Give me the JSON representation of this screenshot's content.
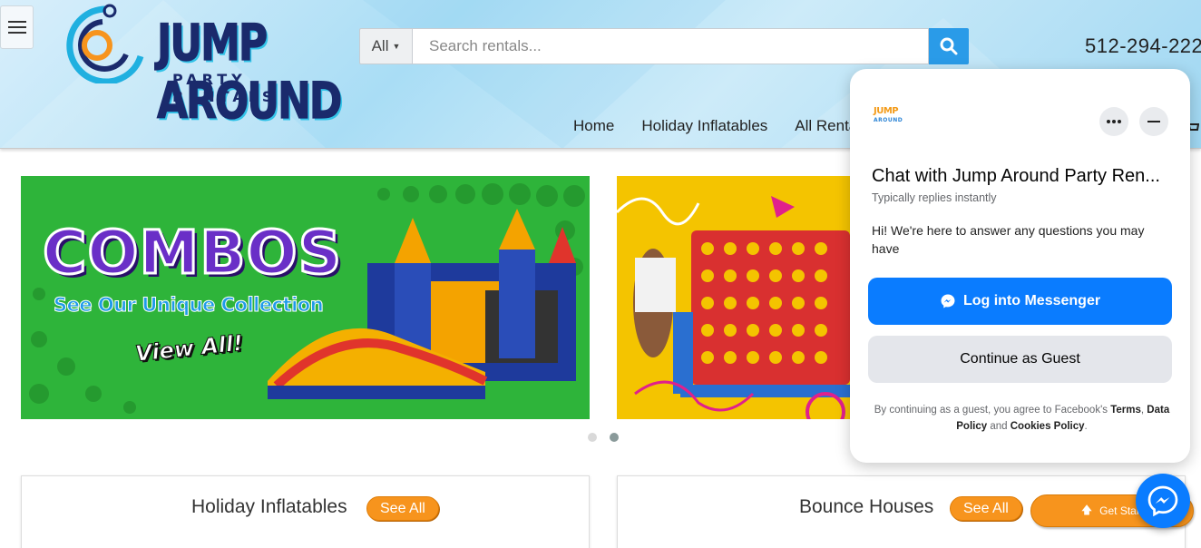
{
  "header": {
    "logo_main": "JUMP AROUND",
    "logo_sub": "PARTY RENTALS",
    "phone": "512-294-222",
    "search": {
      "category": "All",
      "placeholder": "Search rentals..."
    },
    "nav": [
      "Home",
      "Holiday Inflatables",
      "All Renta"
    ]
  },
  "carousel": {
    "slide1": {
      "headline": "COMBOS",
      "subline": "See Our Unique Collection",
      "cta": "View All!"
    },
    "active_index": 2
  },
  "categories": [
    {
      "title": "Holiday Inflatables",
      "button": "See All"
    },
    {
      "title": "Bounce Houses",
      "button": "See All"
    }
  ],
  "get_started": "Get Start",
  "chat": {
    "logo_line1": "JUMP",
    "logo_line2": "AROUND",
    "title": "Chat with Jump Around Party Ren...",
    "status": "Typically replies instantly",
    "message": "Hi! We're here to answer any questions you may have",
    "login_button": "Log into Messenger",
    "guest_button": "Continue as Guest",
    "legal_prefix": "By continuing as a guest, you agree to Facebook's",
    "legal_terms": "Terms",
    "legal_data": "Data Policy",
    "legal_and": "and",
    "legal_cookies": "Cookies Policy"
  },
  "colors": {
    "accent_blue": "#2a9be8",
    "messenger_blue": "#0a7cff",
    "orange": "#f7941d",
    "combo_green": "#2eb43a"
  }
}
